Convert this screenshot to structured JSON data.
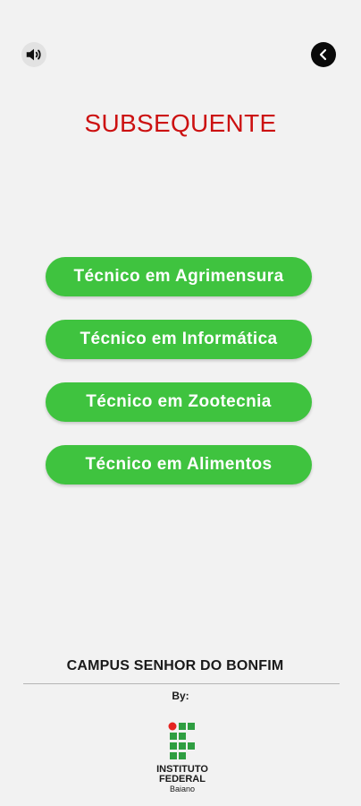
{
  "header": {
    "sound_icon": "speaker-volume-icon",
    "back_icon": "chevron-left-icon",
    "title": "SUBSEQUENTE"
  },
  "courses": [
    {
      "label": "Técnico em Agrimensura"
    },
    {
      "label": "Técnico em Informática"
    },
    {
      "label": "Técnico em Zootecnia"
    },
    {
      "label": "Técnico em Alimentos"
    }
  ],
  "footer": {
    "campus": "CAMPUS SENHOR DO BONFIM",
    "by": "By:",
    "logo": {
      "line1": "INSTITUTO",
      "line2": "FEDERAL",
      "line3": "Baiano"
    }
  },
  "colors": {
    "title": "#cc1111",
    "button": "#3fc33f",
    "logo_red": "#e52421",
    "logo_green": "#2f9e41"
  }
}
